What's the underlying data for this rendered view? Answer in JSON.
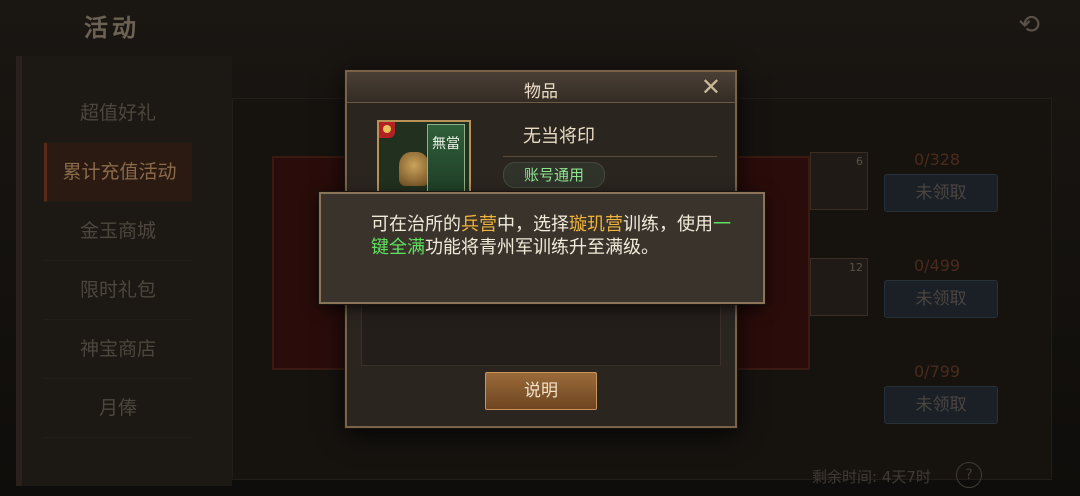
{
  "background": {
    "title": "活动",
    "sidebar": [
      {
        "label": "超值好礼"
      },
      {
        "label": "累计充值活动"
      },
      {
        "label": "金玉商城"
      },
      {
        "label": "限时礼包"
      },
      {
        "label": "神宝商店"
      },
      {
        "label": "月俸"
      }
    ],
    "rows": [
      {
        "progress": "0/328",
        "button": "未领取",
        "count": "6"
      },
      {
        "progress": "0/499",
        "button": "未领取",
        "count": "12"
      },
      {
        "progress": "0/799",
        "button": "未领取",
        "count": ""
      }
    ],
    "remaining_label": "剩余时间:",
    "remaining_value": "4天7时"
  },
  "dialog": {
    "title": "物品",
    "item_name": "无当将印",
    "banner_text": "無當",
    "account_tag": "账号通用",
    "explain_button": "说明"
  },
  "tooltip": {
    "parts": [
      {
        "text": "可在治所的"
      },
      {
        "text": "兵营",
        "color": "#f0b33b"
      },
      {
        "text": "中，选择"
      },
      {
        "text": "璇玑营",
        "color": "#f0b33b"
      },
      {
        "text": "训练，使用"
      },
      {
        "text": "一键全满",
        "color": "#5fe05f"
      },
      {
        "text": "功能将青州军训练升至满级。"
      }
    ]
  },
  "icons": [
    "back-arrow-icon",
    "close-icon",
    "help-icon",
    "seal-item-icon"
  ]
}
